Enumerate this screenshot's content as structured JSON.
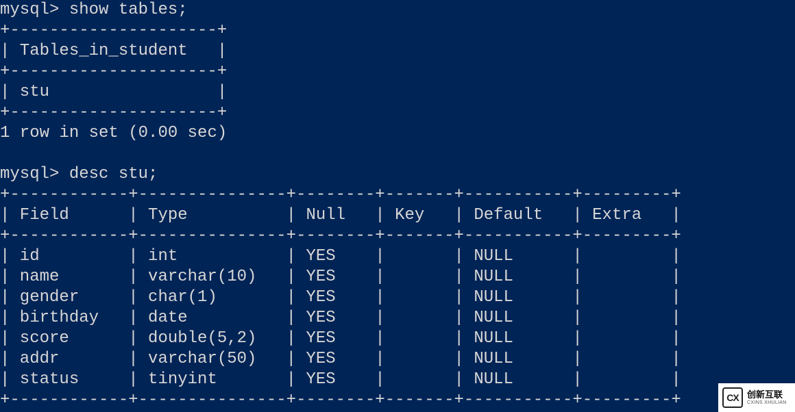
{
  "prompt": "mysql>",
  "commands": {
    "show_tables": "show tables;",
    "desc_stu": "desc stu;"
  },
  "show_tables_result": {
    "header": "Tables_in_student",
    "rows": [
      "stu"
    ],
    "summary": "1 row in set (0.00 sec)"
  },
  "desc_result": {
    "headers": [
      "Field",
      "Type",
      "Null",
      "Key",
      "Default",
      "Extra"
    ],
    "rows": [
      {
        "Field": "id",
        "Type": "int",
        "Null": "YES",
        "Key": "",
        "Default": "NULL",
        "Extra": ""
      },
      {
        "Field": "name",
        "Type": "varchar(10)",
        "Null": "YES",
        "Key": "",
        "Default": "NULL",
        "Extra": ""
      },
      {
        "Field": "gender",
        "Type": "char(1)",
        "Null": "YES",
        "Key": "",
        "Default": "NULL",
        "Extra": ""
      },
      {
        "Field": "birthday",
        "Type": "date",
        "Null": "YES",
        "Key": "",
        "Default": "NULL",
        "Extra": ""
      },
      {
        "Field": "score",
        "Type": "double(5,2)",
        "Null": "YES",
        "Key": "",
        "Default": "NULL",
        "Extra": ""
      },
      {
        "Field": "addr",
        "Type": "varchar(50)",
        "Null": "YES",
        "Key": "",
        "Default": "NULL",
        "Extra": ""
      },
      {
        "Field": "status",
        "Type": "tinyint",
        "Null": "YES",
        "Key": "",
        "Default": "NULL",
        "Extra": ""
      }
    ]
  },
  "col_widths": {
    "small_table_inner": 19,
    "Field": 10,
    "Type": 13,
    "Null": 6,
    "Key": 5,
    "Default": 9,
    "Extra": 7
  },
  "watermark": {
    "logo": "CX",
    "cn": "创新互联",
    "en": "CXINS XHULIAN"
  }
}
